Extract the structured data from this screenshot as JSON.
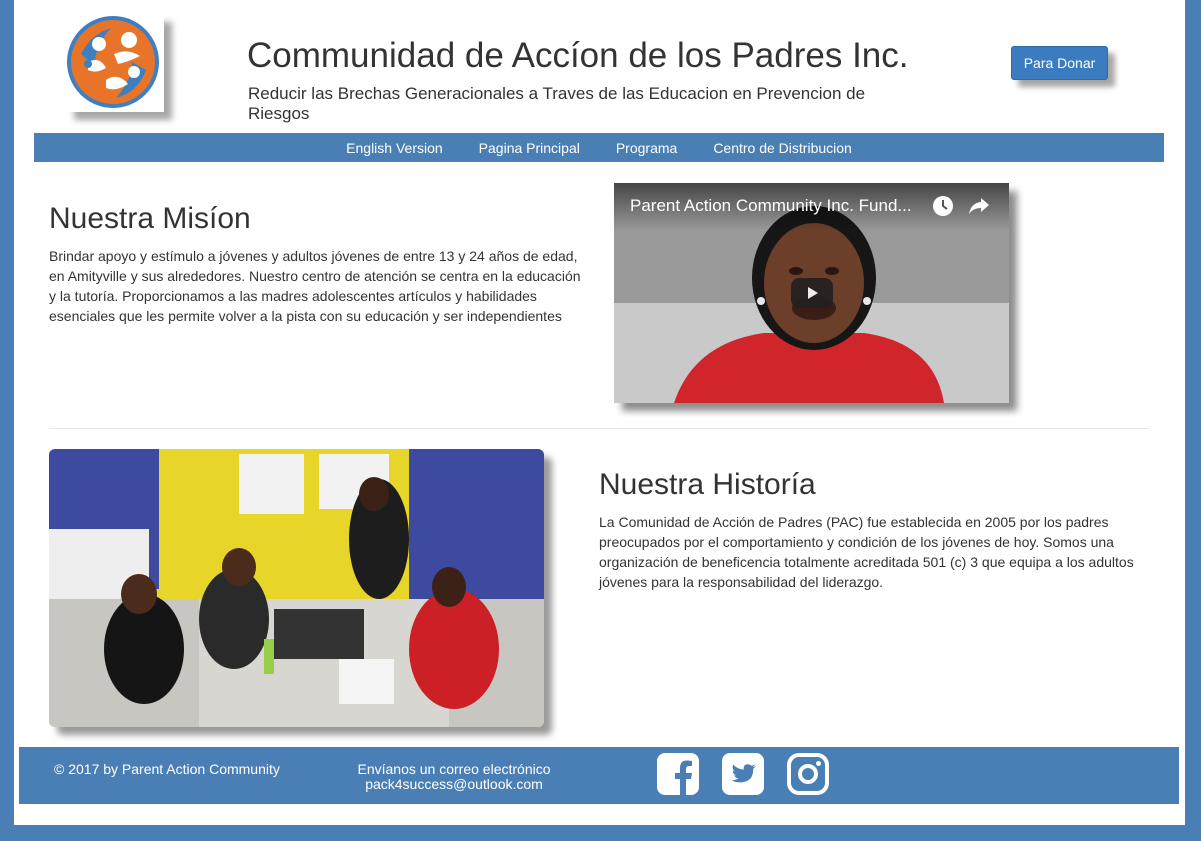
{
  "header": {
    "title": "Communidad de Accíon de los Padres Inc.",
    "subtitle": "Reducir las Brechas Generacionales a Traves de las Educacion en Prevencion de Riesgos",
    "donate_label": "Para Donar"
  },
  "nav": {
    "items": [
      {
        "label": "English Version"
      },
      {
        "label": "Pagina Principal"
      },
      {
        "label": "Programa"
      },
      {
        "label": "Centro de Distribucion"
      }
    ]
  },
  "mission": {
    "title": "Nuestra Misíon",
    "text": "Brindar apoyo y estímulo a jóvenes y adultos jóvenes de entre 13 y 24 años de edad, en Amityville y sus alrededores. Nuestro centro de atención se centra en la educación y la tutoría. Proporcionamos a las madres adolescentes artículos y habilidades esenciales que les permite volver a la pista con su educación y ser independientes"
  },
  "video": {
    "title": "Parent Action Community Inc. Fund...",
    "icons": [
      "watch-later-icon",
      "share-icon",
      "play-icon"
    ]
  },
  "history": {
    "title": "Nuestra Historía",
    "text": "La Comunidad de Acción de Padres (PAC) fue establecida en 2005 por los padres preocupados por el comportamiento y condición de los jóvenes de hoy. Somos una organización de beneficencia totalmente acreditada 501 (c) 3 que equipa a los adultos jóvenes para la responsabilidad del liderazgo."
  },
  "footer": {
    "copyright": "© 2017 by Parent Action Community",
    "email_label": "Envíanos un correo electrónico",
    "email": "pack4success@outlook.com",
    "social": [
      "facebook-icon",
      "twitter-icon",
      "instagram-icon"
    ]
  },
  "colors": {
    "brand_blue": "#4a7fb5",
    "button_blue": "#3a7cbf",
    "text": "#333333",
    "logo_orange": "#e8742a",
    "logo_blue": "#3d7fc1"
  }
}
